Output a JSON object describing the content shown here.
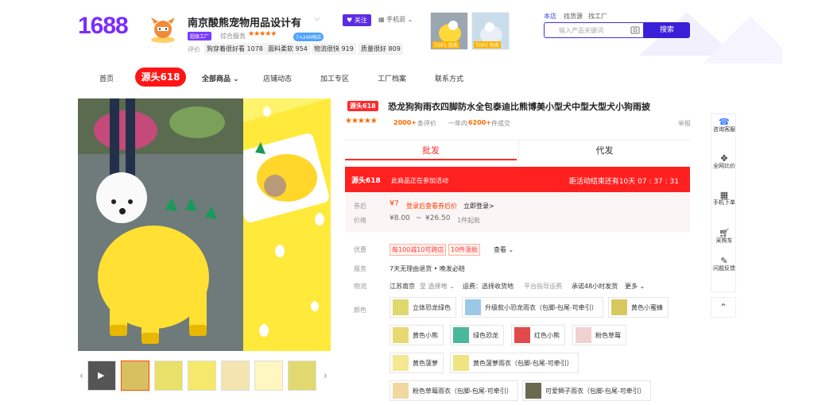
{
  "header": {
    "logo": "1688",
    "shop_name": "南京酸熊宠物用品设计有",
    "follow": "关注",
    "phone_view": "手机逛",
    "badge": "超级工厂",
    "service_score_label": "综合服务",
    "stars": "★★★★★",
    "score_badge": "7×24h响应",
    "review_label": "评价",
    "review_tags": [
      "狗穿着很好看 1078",
      "面料柔软 954",
      "物流很快 919",
      "质量很好 809"
    ],
    "thumbs": [
      "TOP1 热卖",
      "TOP2 热卖"
    ],
    "top_links": [
      "本店",
      "找货源",
      "找工厂"
    ],
    "search_placeholder": "输入产品关键词",
    "search_button": "搜索"
  },
  "nav": {
    "items": [
      "首页",
      "源头618",
      "全部商品",
      "店铺动态",
      "加工专区",
      "工厂档案",
      "联系方式"
    ]
  },
  "product": {
    "tag": "源头618",
    "title": "恐龙狗狗雨衣四脚防水全包泰迪比熊博美小型犬中型大型犬小狗雨披",
    "stars": "★★★★★",
    "review_count": "2000+",
    "review_unit": "条评价",
    "year_label": "一年内",
    "sold": "6200+",
    "sold_unit": "件成交",
    "report": "举报",
    "tab_wholesale": "批发",
    "tab_dropship": "代发",
    "promo_logo": "源头618",
    "promo_text": "此商品正在参加活动",
    "promo_countdown": "距活动结束还有10天 07 : 37 : 31",
    "coupon_label": "券后",
    "coupon_price": "¥?",
    "coupon_link": "登录后查看券后价",
    "login_now": "立即登录>",
    "price_label": "价格",
    "price_low": "¥8.00",
    "price_sep": "~",
    "price_high": "¥26.50",
    "moq": "1件起批",
    "discount_label": "优惠",
    "discount_tags": [
      "每100减10可跨店",
      "10件混批"
    ],
    "discount_more": "查看",
    "service_label": "服务",
    "service_text": "7天无理由退货 • 晚发必赔",
    "logistics_label": "物流",
    "logistics_from": "江苏南京",
    "logistics_to": "至 选择地",
    "logistics_fee": "运费：选择收货地",
    "logistics_note": "平台指导运费",
    "logistics_promise": "承诺48小时发货",
    "logistics_more": "更多",
    "color_label": "颜色",
    "colors": [
      "立体恐龙绿色",
      "升级款小恐龙雨衣（包脚-包尾-可牵引）",
      "黄色小蜜蜂",
      "黄色小熊",
      "绿色恐龙",
      "红色小熊",
      "粉色草莓",
      "黄色菠萝",
      "黄色菠萝雨衣（包脚-包尾-可牵引）",
      "粉色草莓雨衣（包脚-包尾-可牵引）",
      "可爱狮子雨衣（包脚-包尾-可牵引）"
    ]
  },
  "sidebar": {
    "items": [
      "咨询客服",
      "全网比价",
      "手机下单",
      "采购车",
      "问题反馈"
    ]
  },
  "colors": {
    "brand_purple": "#7b2cff",
    "promo_red": "#ff2020",
    "price_orange": "#ff6a00"
  }
}
